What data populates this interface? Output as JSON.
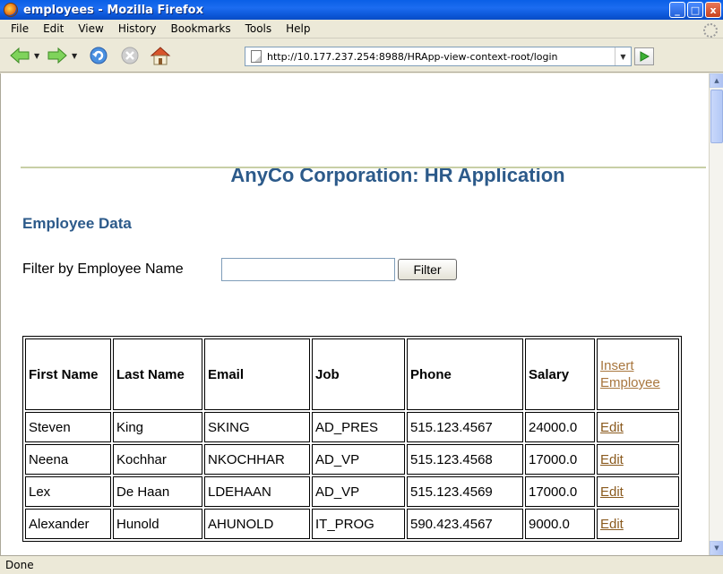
{
  "window": {
    "title": "employees - Mozilla Firefox",
    "minimize": "_",
    "maximize": "□",
    "close": "x"
  },
  "menu": [
    "File",
    "Edit",
    "View",
    "History",
    "Bookmarks",
    "Tools",
    "Help"
  ],
  "nav": {
    "url": "http://10.177.237.254:8988/HRApp-view-context-root/login",
    "icons": [
      "back-icon",
      "forward-icon",
      "reload-icon",
      "stop-icon",
      "home-icon",
      "go-icon"
    ]
  },
  "page": {
    "title": "AnyCo Corporation: HR Application",
    "section": "Employee Data",
    "filter_label": "Filter by Employee Name",
    "filter_value": "",
    "filter_button": "Filter"
  },
  "table": {
    "headers": [
      "First Name",
      "Last Name",
      "Email",
      "Job",
      "Phone",
      "Salary",
      "Insert Employee"
    ],
    "rows": [
      {
        "first": "Steven",
        "last": "King",
        "email": "SKING",
        "job": "AD_PRES",
        "phone": "515.123.4567",
        "salary": "24000.0",
        "action": "Edit"
      },
      {
        "first": "Neena",
        "last": "Kochhar",
        "email": "NKOCHHAR",
        "job": "AD_VP",
        "phone": "515.123.4568",
        "salary": "17000.0",
        "action": "Edit"
      },
      {
        "first": "Lex",
        "last": "De Haan",
        "email": "LDEHAAN",
        "job": "AD_VP",
        "phone": "515.123.4569",
        "salary": "17000.0",
        "action": "Edit"
      },
      {
        "first": "Alexander",
        "last": "Hunold",
        "email": "AHUNOLD",
        "job": "IT_PROG",
        "phone": "590.423.4567",
        "salary": "9000.0",
        "action": "Edit"
      }
    ]
  },
  "status": "Done",
  "colors": {
    "heading": "#2c5a8a",
    "link": "#8a5a1e",
    "titlebar": "#0a5fe6"
  }
}
